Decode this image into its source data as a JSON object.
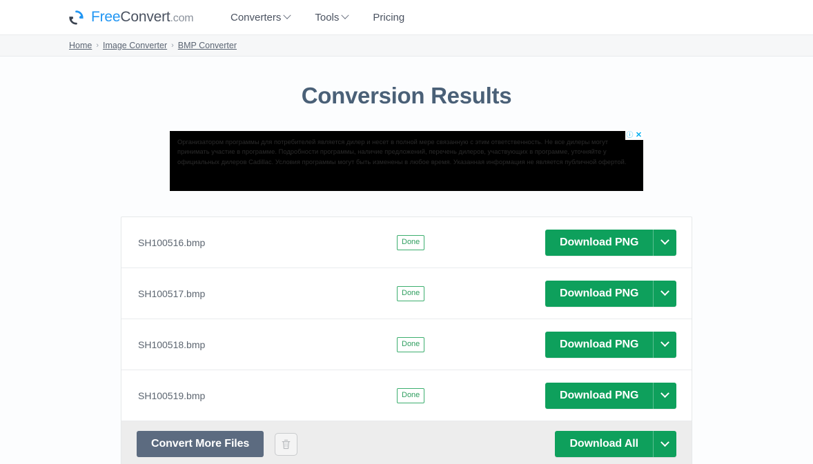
{
  "header": {
    "logo": {
      "icon": "refresh-circle-icon",
      "part_free": "Free",
      "part_convert": "Convert",
      "part_com": ".com"
    },
    "nav": [
      {
        "label": "Converters",
        "has_dropdown": true
      },
      {
        "label": "Tools",
        "has_dropdown": true
      },
      {
        "label": "Pricing",
        "has_dropdown": false
      }
    ]
  },
  "breadcrumb": {
    "separator": "›",
    "items": [
      {
        "label": "Home"
      },
      {
        "label": "Image Converter"
      },
      {
        "label": "BMP Converter"
      }
    ]
  },
  "main": {
    "title": "Conversion Results"
  },
  "ad": {
    "text": "Организатором программы для потребителей является дилер и несет в полной мере связанную с этим ответственность. Не все дилеры могут принимать участие в программе. Подробности программы, наличие предложений, перечень дилеров, участвующих в программе, уточняйте у официальных дилеров Cadillac. Условия программы могут быть изменены в любое время. Указанная информация не является публичной офертой.",
    "info_glyph": "ⓘ",
    "close_glyph": "✕"
  },
  "results": {
    "files": [
      {
        "name": "SH100516.bmp",
        "status": "Done",
        "download_label": "Download PNG"
      },
      {
        "name": "SH100517.bmp",
        "status": "Done",
        "download_label": "Download PNG"
      },
      {
        "name": "SH100518.bmp",
        "status": "Done",
        "download_label": "Download PNG"
      },
      {
        "name": "SH100519.bmp",
        "status": "Done",
        "download_label": "Download PNG"
      }
    ],
    "footer": {
      "convert_more_label": "Convert More Files",
      "delete_icon": "trash-icon",
      "download_all_label": "Download All"
    }
  },
  "colors": {
    "green": "#0ea05c",
    "slate": "#5c6b80",
    "title": "#4a6077",
    "logo_blue": "#2196f3"
  }
}
